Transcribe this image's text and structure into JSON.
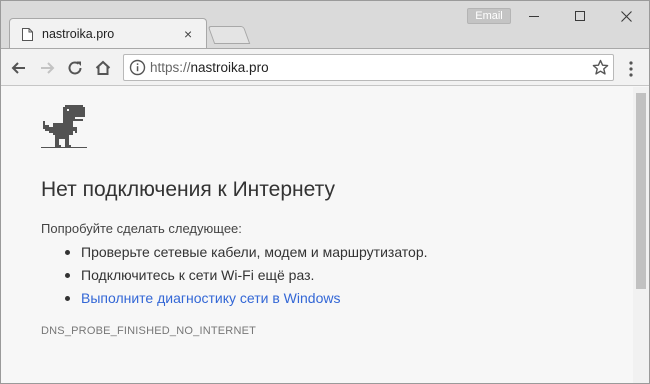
{
  "window": {
    "profile_label": "Email",
    "minimize_icon": "minimize-icon",
    "maximize_icon": "maximize-icon",
    "close_icon": "close-icon"
  },
  "tab": {
    "title": "nastroika.pro",
    "close_glyph": "×"
  },
  "toolbar": {
    "url_protocol": "https://",
    "url_host": "nastroika.pro"
  },
  "page": {
    "heading": "Нет подключения к Интернету",
    "subtext": "Попробуйте сделать следующее:",
    "suggestions": [
      "Проверьте сетевые кабели, модем и маршрутизатор.",
      "Подключитесь к сети Wi-Fi ещё раз.",
      "Выполните диагностику сети в Windows"
    ],
    "error_code": "DNS_PROBE_FINISHED_NO_INTERNET"
  },
  "colors": {
    "link": "#3367d6",
    "heading": "#333333",
    "error_code": "#777777"
  }
}
